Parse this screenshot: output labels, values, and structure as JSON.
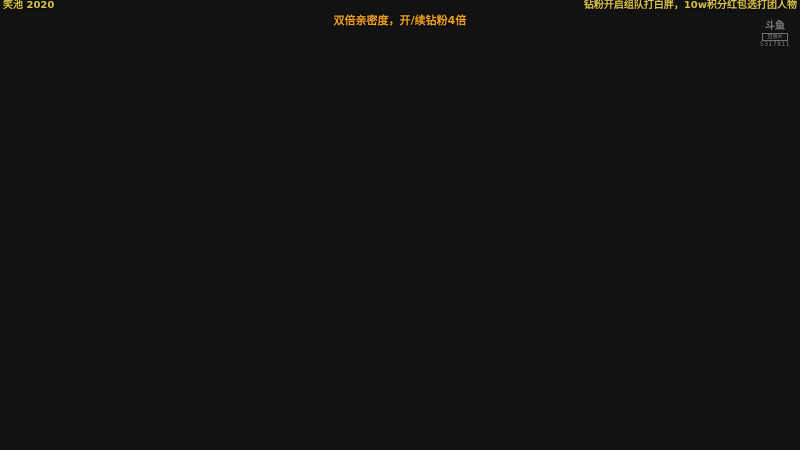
{
  "overlay": {
    "top_left_text": "笑池 2020",
    "top_right_text": "钻粉开启组队打白胖，10w积分红包选打团人物",
    "center_banner_text": "双倍亲密度，开/续钻粉4倍"
  },
  "watermark": {
    "logo_text": "斗鱼",
    "box_text": "直播间",
    "room_id": "5317811"
  },
  "colors": {
    "background": "#131212",
    "overlay_text": "#d8c24a",
    "banner_text": "#f0a020"
  }
}
